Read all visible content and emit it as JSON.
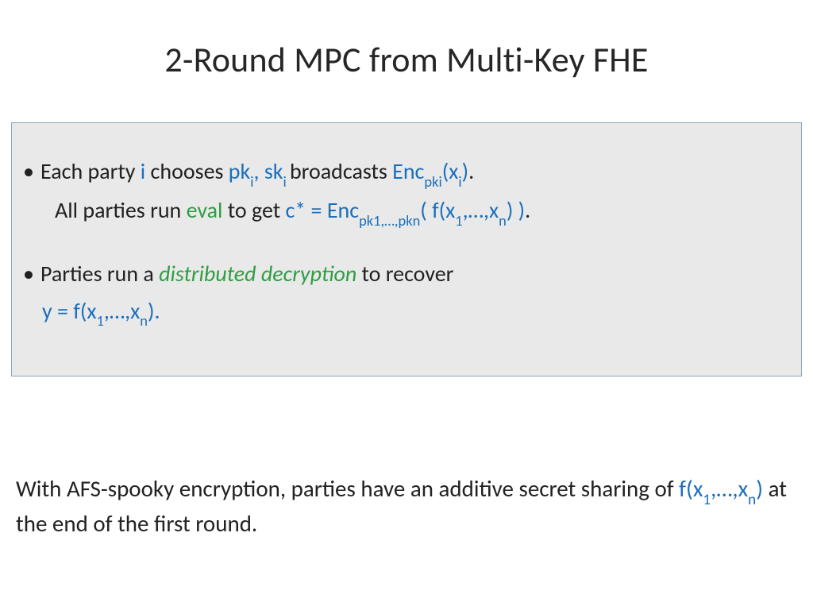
{
  "title": "2-Round MPC from Multi-Key FHE",
  "bullets": {
    "b1": {
      "lead": "Each party ",
      "i": "i",
      "chooses": " chooses ",
      "pk": "pk",
      "sub_i1": "i",
      "comma": ", ",
      "sk": "sk",
      "sub_i2": "i ",
      "broadcasts": "broadcasts  ",
      "enc": "Enc",
      "enc_sub": "pki",
      "open": "(x",
      "x_sub": "i",
      "close": ")",
      "period": "."
    },
    "b1cont": {
      "all": "All parties run ",
      "eval": "eval",
      "toget": " to get  ",
      "cstar": "c* = Enc",
      "cstar_sub": "pk1,…,pkn",
      "fopen": "( f(x",
      "one": "1",
      "dots": ",…,x",
      "n": "n",
      "fclose": ") )",
      "period2": "."
    },
    "b2": {
      "parties": "Parties run a ",
      "dd": "distributed decryption",
      "recover": " to recover"
    },
    "b2cont": {
      "y": "y =  f(x",
      "one": "1",
      "dots": ",…,x",
      "n": "n",
      "close": ")."
    }
  },
  "footer": {
    "a": "With AFS-spooky encryption, parties have an additive secret sharing of ",
    "f": "f(x",
    "one": "1",
    "dots": ",…,x",
    "n": "n",
    "close": ")",
    "b": " at the end of the first round."
  }
}
